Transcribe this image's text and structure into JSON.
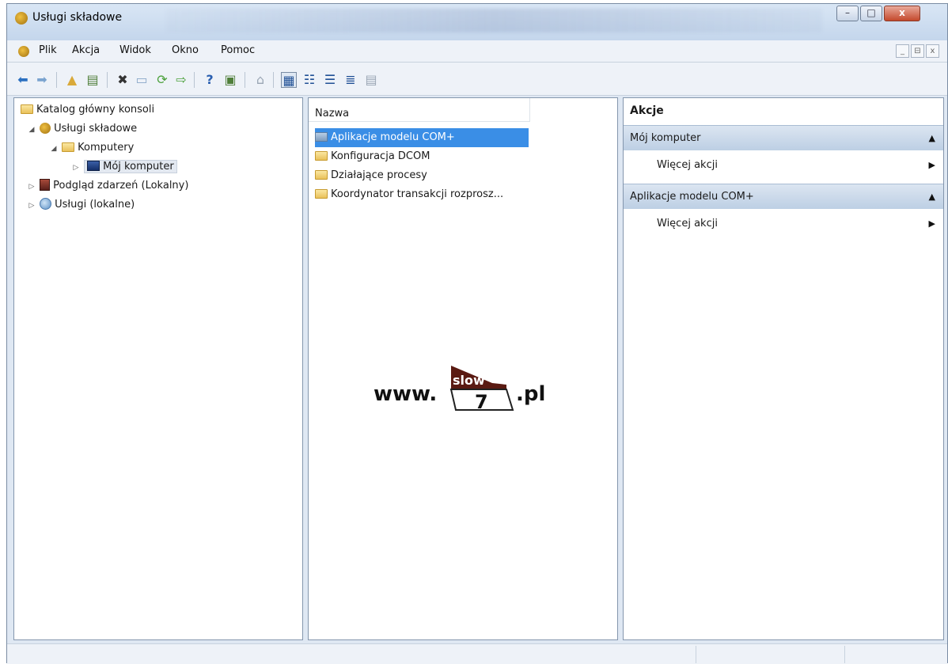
{
  "window": {
    "title": "Usługi składowe",
    "controls": {
      "minimize": "–",
      "maximize": "□",
      "close": "x"
    }
  },
  "menubar": {
    "items": [
      "Plik",
      "Akcja",
      "Widok",
      "Okno",
      "Pomoc"
    ],
    "mdi_controls": [
      "_",
      "⊟",
      "x"
    ]
  },
  "tree": {
    "root": "Katalog główny konsoli",
    "component_services": "Usługi składowe",
    "computers": "Komputery",
    "my_computer": "Mój komputer",
    "event_viewer": "Podgląd zdarzeń (Lokalny)",
    "services_local": "Usługi (lokalne)"
  },
  "list": {
    "column_header": "Nazwa",
    "items": [
      "Aplikacje modelu COM+",
      "Konfiguracja DCOM",
      "Działające procesy",
      "Koordynator transakcji rozprosz..."
    ]
  },
  "actions": {
    "title": "Akcje",
    "sections": [
      {
        "label": "Mój komputer",
        "more": "Więcej akcji"
      },
      {
        "label": "Aplikacje modelu COM+",
        "more": "Więcej akcji"
      }
    ]
  },
  "watermark": {
    "prefix": "www.",
    "logo_top": "slow",
    "logo_digit": "7",
    "suffix": ".pl"
  }
}
